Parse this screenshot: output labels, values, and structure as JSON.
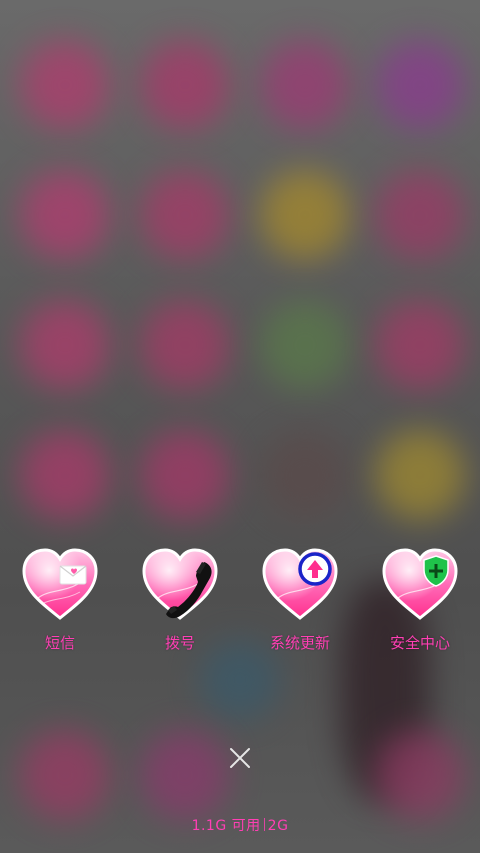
{
  "dock": {
    "apps": [
      {
        "label": "短信",
        "icon": "message-heart-icon"
      },
      {
        "label": "拨号",
        "icon": "phone-heart-icon"
      },
      {
        "label": "系统更新",
        "icon": "update-heart-icon"
      },
      {
        "label": "安全中心",
        "icon": "security-heart-icon"
      }
    ]
  },
  "memory": {
    "available": "1.1G 可用",
    "total": "2G"
  },
  "colors": {
    "accent": "#ff3fb4",
    "heart_light": "#ffb3dc",
    "heart_dark": "#ff2f8e"
  }
}
